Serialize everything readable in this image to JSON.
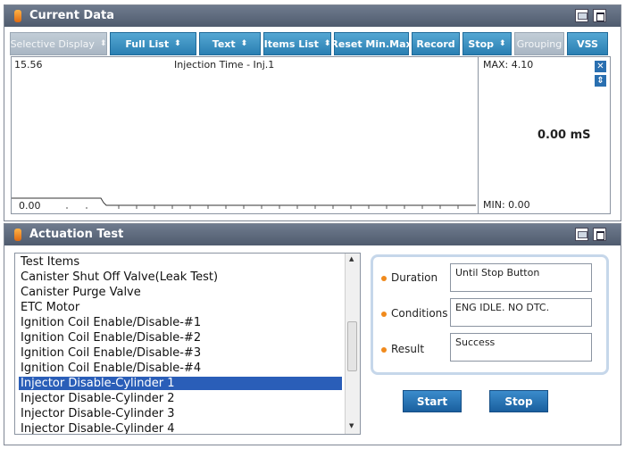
{
  "current_data": {
    "title": "Current Data",
    "toolbar": [
      {
        "label": "Selective Display",
        "arrow": "⬍",
        "enabled": false
      },
      {
        "label": "Full List",
        "arrow": "⬍",
        "enabled": true
      },
      {
        "label": "Text",
        "arrow": "⬍",
        "enabled": true
      },
      {
        "label": "Items List",
        "arrow": "⬍",
        "enabled": true
      },
      {
        "label": "Reset Min.Max",
        "arrow": "",
        "enabled": true
      },
      {
        "label": "Record",
        "arrow": "",
        "enabled": true
      },
      {
        "label": "Stop",
        "arrow": "⬍",
        "enabled": true
      },
      {
        "label": "Grouping",
        "arrow": "",
        "enabled": false
      },
      {
        "label": "VSS",
        "arrow": "",
        "enabled": true
      }
    ],
    "graph": {
      "y_top": "15.56",
      "y_bottom": "0.00",
      "signal_name": "Injection Time - Inj.1",
      "max_label": "MAX: 4.10",
      "min_label": "MIN: 0.00",
      "current_value": "0.00 mS"
    }
  },
  "actuation_test": {
    "title": "Actuation Test",
    "list_header": "Test Items",
    "items": [
      "Canister Shut Off Valve(Leak Test)",
      "Canister Purge Valve",
      "ETC Motor",
      "Ignition Coil Enable/Disable-#1",
      "Ignition Coil Enable/Disable-#2",
      "Ignition Coil Enable/Disable-#3",
      "Ignition Coil Enable/Disable-#4",
      "Injector Disable-Cylinder 1",
      "Injector Disable-Cylinder 2",
      "Injector Disable-Cylinder 3",
      "Injector Disable-Cylinder 4"
    ],
    "selected_index": 7,
    "fields": {
      "duration_label": "Duration",
      "duration_value": "Until Stop Button",
      "conditions_label": "Conditions",
      "conditions_value": "ENG IDLE. NO DTC.",
      "result_label": "Result",
      "result_value": "Success"
    },
    "start_label": "Start",
    "stop_label": "Stop"
  }
}
